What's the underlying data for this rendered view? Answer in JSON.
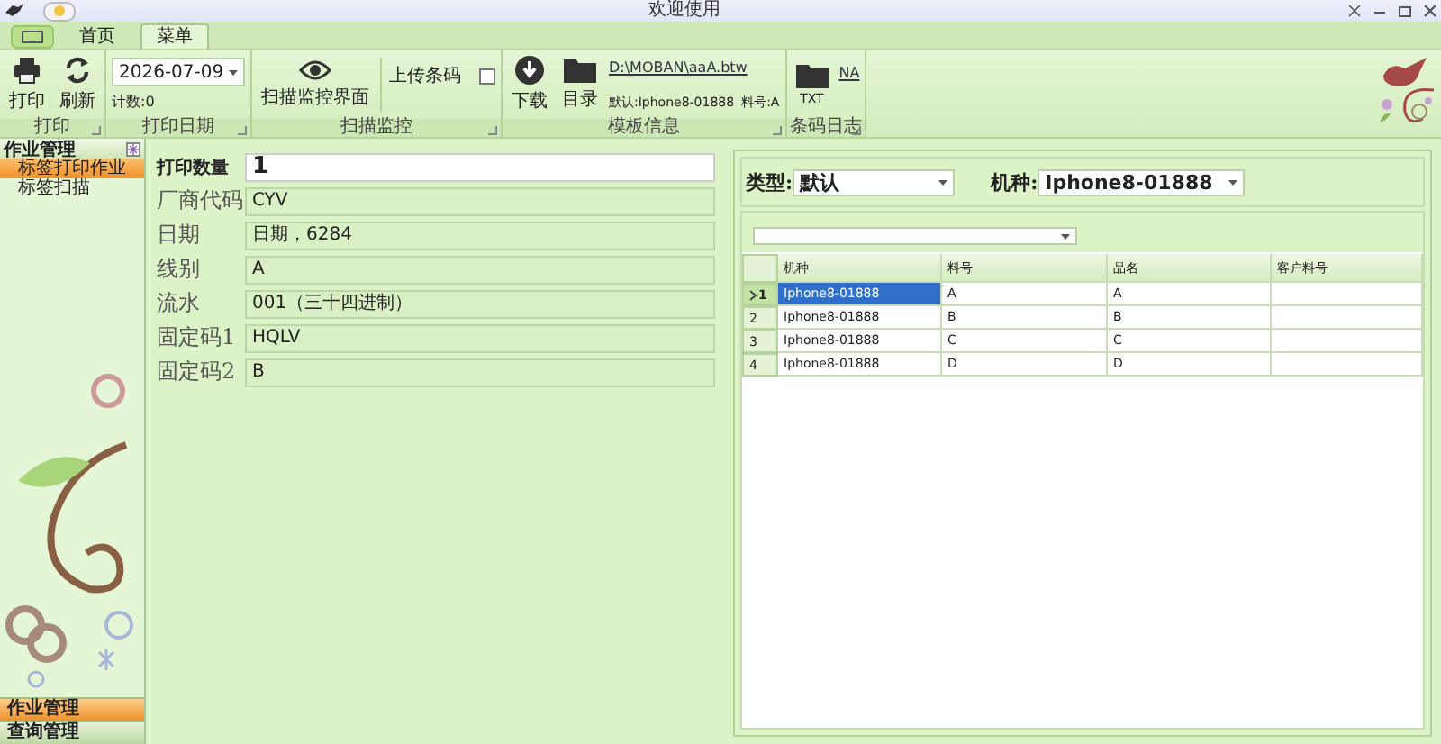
{
  "window": {
    "title": "欢迎使用"
  },
  "tabs": [
    {
      "label": "首页",
      "selected": false
    },
    {
      "label": "菜单",
      "selected": true
    }
  ],
  "ribbon": {
    "print_group": {
      "label": "打印",
      "buttons": [
        "打印",
        "刷新"
      ]
    },
    "date_group": {
      "label": "打印日期",
      "date": "2026-07-09",
      "count": "计数:0"
    },
    "scan_group": {
      "label": "扫描监控",
      "monitor_button": "扫描监控界面",
      "upload": {
        "label": "上传条码",
        "checked": false
      }
    },
    "template_group": {
      "label": "模板信息",
      "buttons": [
        "下载",
        "目录"
      ],
      "path_link": "D:\\MOBAN\\aaA.btw",
      "default": "默认:Iphone8-01888",
      "part_no": "料号:A"
    },
    "log_group": {
      "label": "条码日志",
      "button": "TXT",
      "link": "NA"
    }
  },
  "sidebar": {
    "header": "作业管理",
    "items": [
      {
        "label": "标签打印作业",
        "selected": true
      },
      {
        "label": "标签扫描",
        "selected": false
      }
    ],
    "sections": [
      {
        "label": "作业管理",
        "selected": true
      },
      {
        "label": "查询管理",
        "selected": false
      }
    ]
  },
  "form": {
    "quantity": {
      "label": "打印数量",
      "value": "1"
    },
    "fields": [
      {
        "label": "厂商代码",
        "value": "CYV"
      },
      {
        "label": "日期",
        "value": "日期，6284"
      },
      {
        "label": "线别",
        "value": "A"
      },
      {
        "label": "流水",
        "value": "001（三十四进制）"
      },
      {
        "label": "固定码1",
        "value": "HQLV"
      },
      {
        "label": "固定码2",
        "value": "B"
      }
    ]
  },
  "filters": {
    "type": {
      "label": "类型:",
      "value": "默认"
    },
    "model": {
      "label": "机种:",
      "value": "Iphone8-01888"
    }
  },
  "table": {
    "columns": [
      "机种",
      "料号",
      "品名",
      "客户料号"
    ],
    "rows": [
      {
        "index": "1",
        "selected": true,
        "cells": [
          "Iphone8-01888",
          "A",
          "A",
          ""
        ]
      },
      {
        "index": "2",
        "selected": false,
        "cells": [
          "Iphone8-01888",
          "B",
          "B",
          ""
        ]
      },
      {
        "index": "3",
        "selected": false,
        "cells": [
          "Iphone8-01888",
          "C",
          "C",
          ""
        ]
      },
      {
        "index": "4",
        "selected": false,
        "cells": [
          "Iphone8-01888",
          "D",
          "D",
          ""
        ]
      }
    ]
  }
}
